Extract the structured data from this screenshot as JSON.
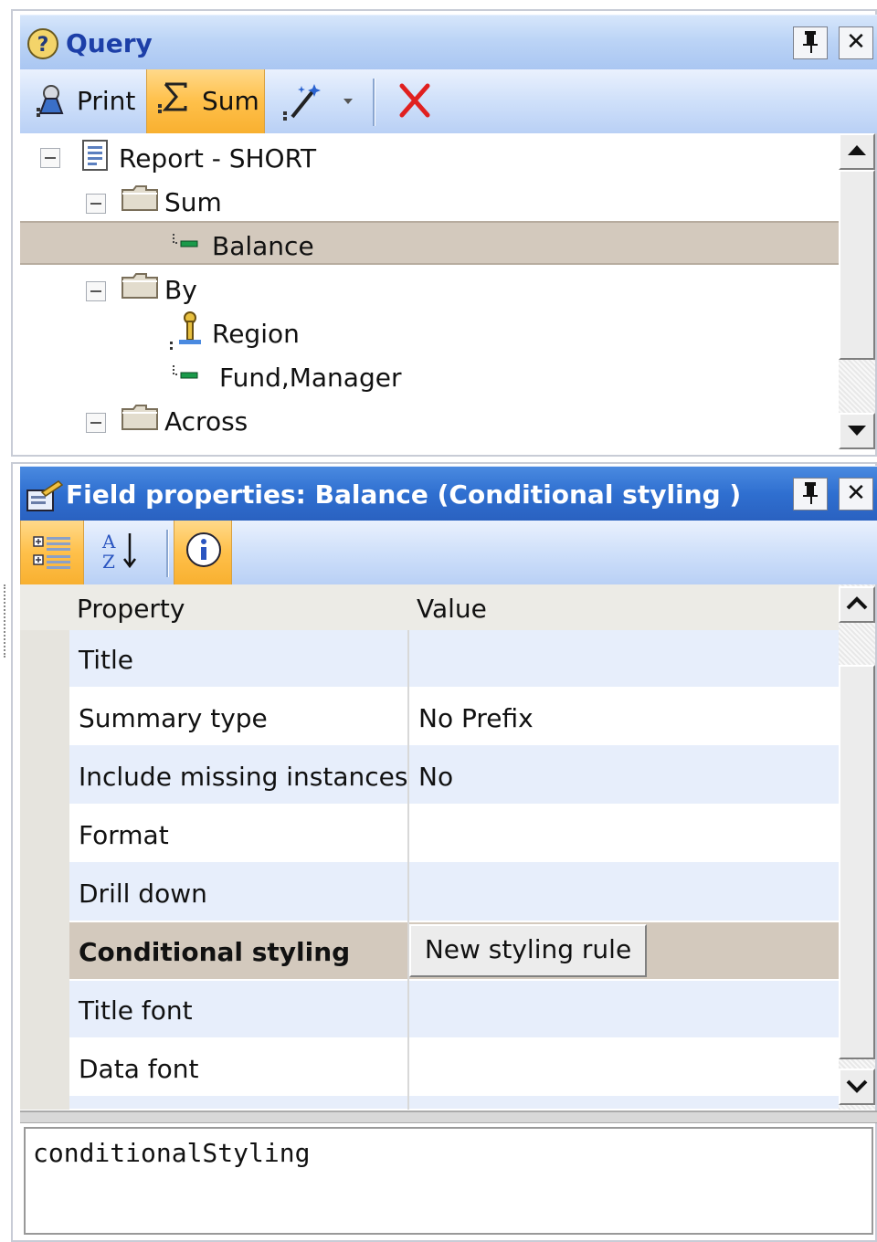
{
  "query_panel": {
    "title": "Query",
    "pin_label": "⚀",
    "close_label": "✕",
    "toolbar": {
      "print_label": "Print",
      "sum_label": "Sum",
      "active_button": "Sum"
    },
    "tree": [
      {
        "label": "Report - SHORT",
        "icon": "report-icon",
        "expanded": true
      },
      {
        "label": "Sum",
        "icon": "folder-icon",
        "expanded": true
      },
      {
        "label": "Balance",
        "icon": "field-icon",
        "selected": true
      },
      {
        "label": "By",
        "icon": "folder-icon",
        "expanded": true
      },
      {
        "label": "Region",
        "icon": "key-icon"
      },
      {
        "label": "Fund,Manager",
        "icon": "field-icon"
      },
      {
        "label": "Across",
        "icon": "folder-icon",
        "expanded": true
      }
    ]
  },
  "props_panel": {
    "title": "Field properties: Balance (Conditional styling )",
    "pin_label": "⚀",
    "close_label": "✕",
    "header": {
      "property": "Property",
      "value": "Value"
    },
    "rows": [
      {
        "name": "Title",
        "value": ""
      },
      {
        "name": "Summary type",
        "value": "No Prefix"
      },
      {
        "name": "Include missing instances",
        "value": "No"
      },
      {
        "name": "Format",
        "value": ""
      },
      {
        "name": "Drill down",
        "value": ""
      },
      {
        "name": "Conditional styling",
        "value": "New styling rule",
        "selected": true
      },
      {
        "name": "Title font",
        "value": ""
      },
      {
        "name": "Data font",
        "value": ""
      }
    ],
    "description": "conditionalStyling"
  },
  "colors": {
    "title_light": "#bcd4f6",
    "title_dark": "#2f6fd0",
    "active_orange": "#ffc04a",
    "selection": "#d3c9bd",
    "row_alt": "#e7eefb",
    "delete_red": "#e02020"
  }
}
